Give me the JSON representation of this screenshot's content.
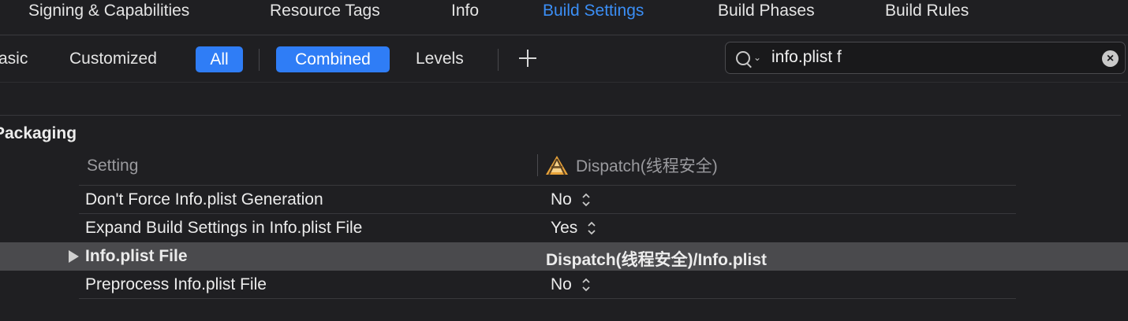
{
  "tabs": {
    "signing": "Signing & Capabilities",
    "resource_tags": "Resource Tags",
    "info": "Info",
    "build_settings": "Build Settings",
    "build_phases": "Build Phases",
    "build_rules": "Build Rules"
  },
  "filters": {
    "basic": "asic",
    "customized": "Customized",
    "all": "All",
    "combined": "Combined",
    "levels": "Levels"
  },
  "search": {
    "value": "info.plist f"
  },
  "section": {
    "title": "Packaging"
  },
  "header": {
    "setting": "Setting",
    "target": "Dispatch(线程安全)"
  },
  "rows": [
    {
      "name": "Don't Force Info.plist Generation",
      "value": "No"
    },
    {
      "name": "Expand Build Settings in Info.plist File",
      "value": "Yes"
    },
    {
      "name": "Info.plist File",
      "value": "Dispatch(线程安全)/Info.plist"
    },
    {
      "name": "Preprocess Info.plist File",
      "value": "No"
    }
  ],
  "colors": {
    "accent": "#2f7df6",
    "active_tab": "#3b8ef5",
    "background": "#1f1f22"
  }
}
